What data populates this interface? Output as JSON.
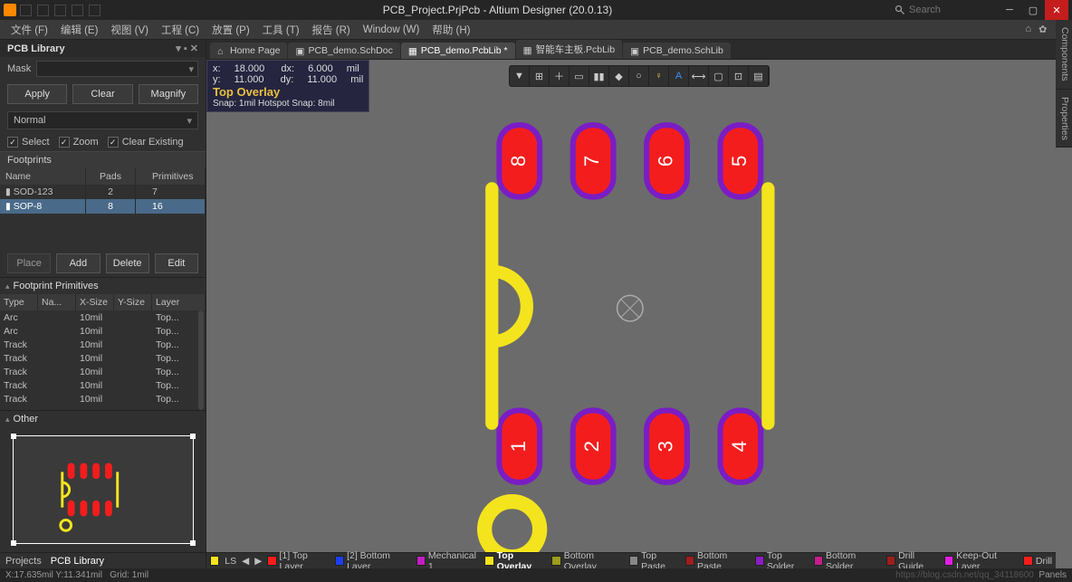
{
  "app": {
    "title": "PCB_Project.PrjPcb - Altium Designer (20.0.13)",
    "search_placeholder": "Search"
  },
  "menu": [
    "文件 (F)",
    "编辑 (E)",
    "视图 (V)",
    "工程 (C)",
    "放置 (P)",
    "工具 (T)",
    "报告 (R)",
    "Window (W)",
    "帮助 (H)"
  ],
  "left": {
    "panel_title": "PCB Library",
    "mask_label": "Mask",
    "btns": {
      "apply": "Apply",
      "clear": "Clear",
      "magnify": "Magnify"
    },
    "normal": "Normal",
    "checks": {
      "select": "Select",
      "zoom": "Zoom",
      "clear_existing": "Clear Existing"
    },
    "footprints_header": "Footprints",
    "grid_cols": {
      "name": "Name",
      "pads": "Pads",
      "prim": "Primitives"
    },
    "footprints": [
      {
        "name": "SOD-123",
        "pads": "2",
        "prim": "7"
      },
      {
        "name": "SOP-8",
        "pads": "8",
        "prim": "16"
      }
    ],
    "btns2": {
      "place": "Place",
      "add": "Add",
      "delete": "Delete",
      "edit": "Edit"
    },
    "prim_header": "Footprint Primitives",
    "prim_cols": {
      "type": "Type",
      "na": "Na...",
      "x": "X-Size",
      "y": "Y-Size",
      "layer": "Layer"
    },
    "primitives": [
      {
        "type": "Arc",
        "na": "",
        "x": "10mil",
        "y": "",
        "layer": "Top..."
      },
      {
        "type": "Arc",
        "na": "",
        "x": "10mil",
        "y": "",
        "layer": "Top..."
      },
      {
        "type": "Track",
        "na": "",
        "x": "10mil",
        "y": "",
        "layer": "Top..."
      },
      {
        "type": "Track",
        "na": "",
        "x": "10mil",
        "y": "",
        "layer": "Top..."
      },
      {
        "type": "Track",
        "na": "",
        "x": "10mil",
        "y": "",
        "layer": "Top..."
      },
      {
        "type": "Track",
        "na": "",
        "x": "10mil",
        "y": "",
        "layer": "Top..."
      },
      {
        "type": "Track",
        "na": "",
        "x": "10mil",
        "y": "",
        "layer": "Top..."
      }
    ],
    "other_header": "Other"
  },
  "doc_tabs": [
    {
      "label": "Home Page",
      "icon": "home"
    },
    {
      "label": "PCB_demo.SchDoc",
      "icon": "sch"
    },
    {
      "label": "PCB_demo.PcbLib *",
      "icon": "pcb",
      "active": true
    },
    {
      "label": "智能车主板.PcbLib",
      "icon": "pcb"
    },
    {
      "label": "PCB_demo.SchLib",
      "icon": "sch"
    }
  ],
  "coord": {
    "x_lbl": "x:",
    "x": "18.000",
    "dx_lbl": "dx:",
    "dx": "6.000",
    "unit1": "mil",
    "y_lbl": "y:",
    "y": "11.000",
    "dy_lbl": "dy:",
    "dy": "11.000",
    "unit2": "mil",
    "layer": "Top Overlay",
    "snap": "Snap: 1mil Hotspot Snap: 8mil"
  },
  "pads": [
    "8",
    "7",
    "6",
    "5",
    "1",
    "2",
    "3",
    "4"
  ],
  "right_tabs": [
    "Components",
    "Properties"
  ],
  "bottom_left_tabs": [
    "Projects",
    "PCB Library"
  ],
  "layers": {
    "ls": "LS",
    "items": [
      {
        "c": "#f41d1d",
        "label": "[1] Top Layer"
      },
      {
        "c": "#1d3df4",
        "label": "[2] Bottom Layer"
      },
      {
        "c": "#c41dc4",
        "label": "Mechanical 1"
      },
      {
        "c": "#f4e41d",
        "label": "Top Overlay",
        "bold": true
      },
      {
        "c": "#9c9c1d",
        "label": "Bottom Overlay"
      },
      {
        "c": "#888888",
        "label": "Top Paste"
      },
      {
        "c": "#a01d1d",
        "label": "Bottom Paste"
      },
      {
        "c": "#8c1dc4",
        "label": "Top Solder"
      },
      {
        "c": "#c41d8c",
        "label": "Bottom Solder"
      },
      {
        "c": "#a01d1d",
        "label": "Drill Guide"
      },
      {
        "c": "#e41de4",
        "label": "Keep-Out Layer"
      },
      {
        "c": "#f41d1d",
        "label": "Drill"
      }
    ]
  },
  "status": {
    "coord": "X:17.635mil Y:11.341mil",
    "grid": "Grid: 1mil",
    "watermark": "https://blog.csdn.net/qq_34118600",
    "panels": "Panels"
  },
  "colors": {
    "pad_fill": "#f41d1d",
    "pad_ring": "#7a1dc4",
    "overlay": "#f4e41d",
    "origin": "#aaaaaa",
    "canvas": "#6b6b6b"
  }
}
